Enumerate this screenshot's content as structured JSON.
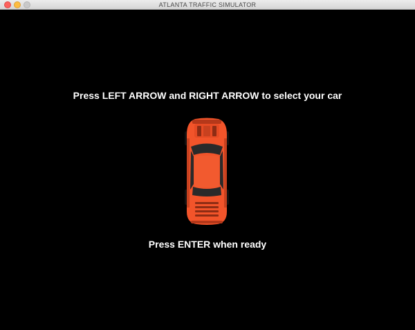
{
  "window": {
    "title": "ATLANTA TRAFFIC SIMULATOR"
  },
  "game": {
    "select_prompt": "Press LEFT ARROW and RIGHT ARROW to select your car",
    "ready_prompt": "Press ENTER when ready",
    "selected_car": {
      "icon": "sports-car-icon",
      "color": "#f2542a"
    }
  },
  "colors": {
    "background": "#000000",
    "text": "#ffffff"
  }
}
